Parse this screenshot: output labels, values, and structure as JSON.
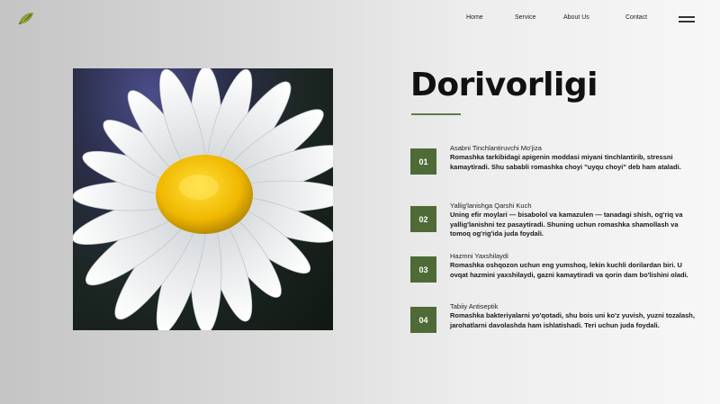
{
  "brand": {
    "logo_icon": "leaf-icon",
    "accent": "#4e6a36"
  },
  "nav": {
    "items": [
      {
        "label": "Home"
      },
      {
        "label": "Service"
      },
      {
        "label": "About Us"
      },
      {
        "label": "Contact"
      }
    ],
    "menu_icon": "hamburger-icon"
  },
  "hero": {
    "image_icon": "chamomile-flower-image",
    "title": "Dorivorligi"
  },
  "features": [
    {
      "number": "01",
      "title": "Asabni Tinchlantiruvchi Mo'jiza",
      "description": "Romashka tarkibidagi apigenin moddasi miyani tinchlantirib, stressni kamaytiradi. Shu sababli romashka choyi \"uyqu choyi\" deb ham ataladi."
    },
    {
      "number": "02",
      "title": "Yallig'lanishga Qarshi Kuch",
      "description": "Uning efir moylari — bisabolol va kamazulen — tanadagi shish, og'riq va yallig'lanishni tez pasaytiradi. Shuning uchun romashka shamollash va tomoq og'rig'ida juda foydali."
    },
    {
      "number": "03",
      "title": "Hazmni Yaxshilaydi",
      "description": "Romashka oshqozon uchun eng yumshoq, lekin kuchli dorilardan biri. U ovqat hazmini yaxshilaydi, gazni kamaytiradi va qorin dam bo'lishini oladi."
    },
    {
      "number": "04",
      "title": "Tabiiy Antiseptik",
      "description": "Romashka bakteriyalarni yo'qotadi, shu bois uni ko'z yuvish, yuzni tozalash, jarohatlarni davolashda ham ishlatishadi. Teri uchun juda foydali."
    }
  ]
}
